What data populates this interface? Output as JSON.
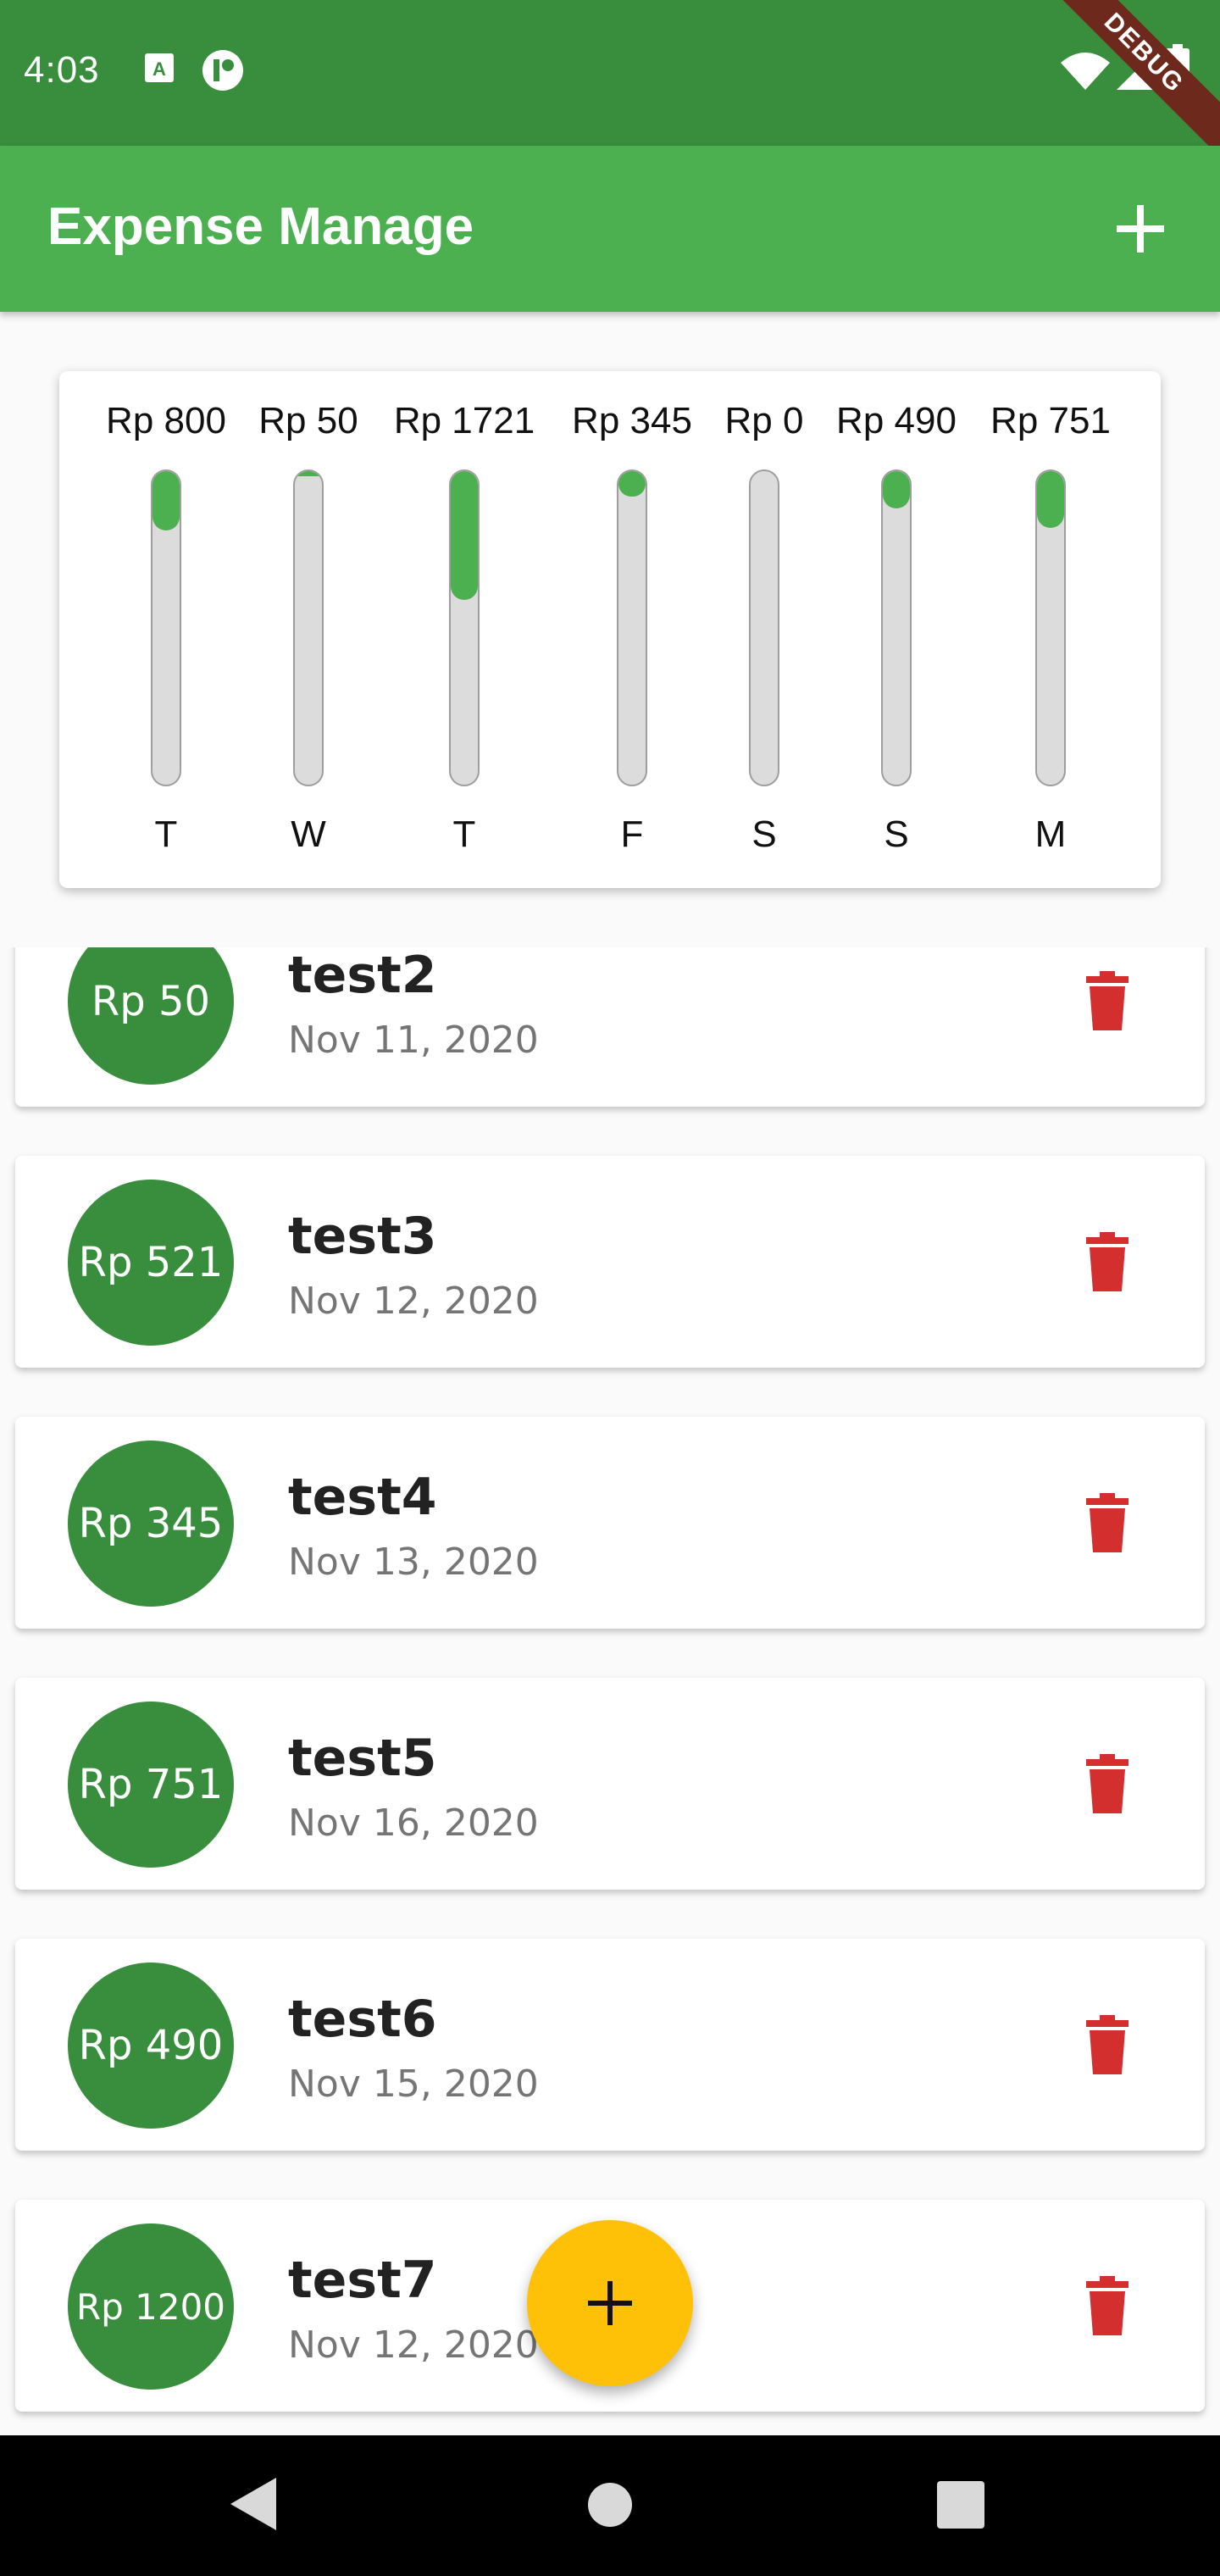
{
  "status": {
    "time": "4:03",
    "debug_label": "DEBUG"
  },
  "appbar": {
    "title": "Expense Manage"
  },
  "chart_data": {
    "type": "bar",
    "categories": [
      "T",
      "W",
      "T",
      "F",
      "S",
      "S",
      "M"
    ],
    "labels": [
      "Rp 800",
      "Rp 50",
      "Rp 1721",
      "Rp 345",
      "Rp 0",
      "Rp 490",
      "Rp 751"
    ],
    "values": [
      800,
      50,
      1721,
      345,
      0,
      490,
      751
    ],
    "fill_fraction": [
      0.19,
      0.01,
      0.41,
      0.08,
      0.0,
      0.12,
      0.18
    ]
  },
  "transactions": [
    {
      "title": "test2",
      "date": "Nov 11, 2020",
      "amount": "Rp 50"
    },
    {
      "title": "test3",
      "date": "Nov 12, 2020",
      "amount": "Rp 521"
    },
    {
      "title": "test4",
      "date": "Nov 13, 2020",
      "amount": "Rp 345"
    },
    {
      "title": "test5",
      "date": "Nov 16, 2020",
      "amount": "Rp 751"
    },
    {
      "title": "test6",
      "date": "Nov 15, 2020",
      "amount": "Rp 490"
    },
    {
      "title": "test7",
      "date": "Nov 12, 2020",
      "amount": "Rp 1200"
    }
  ],
  "colors": {
    "primary": "#4caf50",
    "primary_dark": "#388e3c",
    "accent": "#ffc107",
    "delete": "#d32f2f"
  }
}
